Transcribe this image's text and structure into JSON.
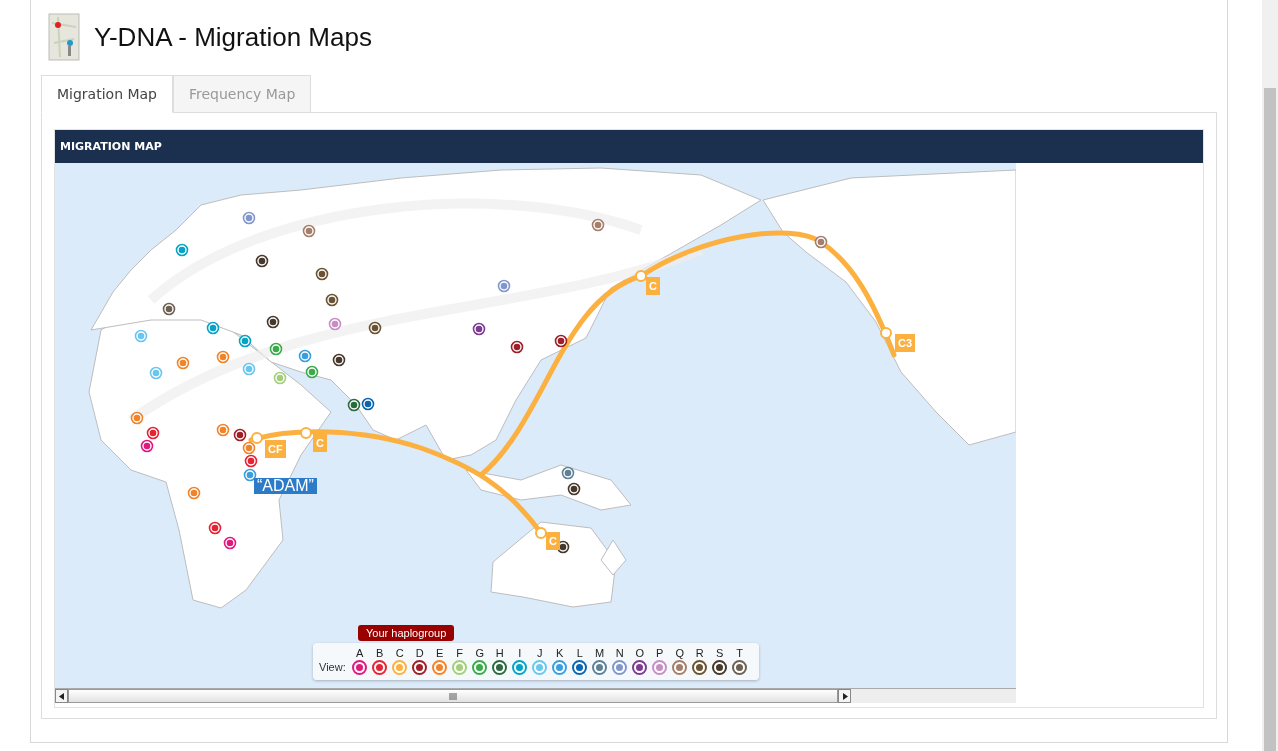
{
  "page": {
    "title": "Y-DNA - Migration Maps"
  },
  "tabs": [
    {
      "label": "Migration Map",
      "selected": true
    },
    {
      "label": "Frequency Map",
      "selected": false
    }
  ],
  "panel": {
    "title": "MIGRATION MAP"
  },
  "map": {
    "labels": [
      {
        "text": "CF",
        "kind": "route"
      },
      {
        "text": "C",
        "kind": "route"
      },
      {
        "text": "C",
        "kind": "route"
      },
      {
        "text": "C3",
        "kind": "route"
      },
      {
        "text": "C",
        "kind": "route"
      },
      {
        "text": "“ADAM”",
        "kind": "origin"
      }
    ]
  },
  "legend": {
    "label": "View:",
    "items": [
      {
        "letter": "A",
        "color": "#e0197d"
      },
      {
        "letter": "B",
        "color": "#e52334"
      },
      {
        "letter": "C",
        "color": "#fbb040",
        "tooltip": "Your haplogroup"
      },
      {
        "letter": "D",
        "color": "#9e1f27"
      },
      {
        "letter": "E",
        "color": "#f0842a"
      },
      {
        "letter": "F",
        "color": "#a3cf7a"
      },
      {
        "letter": "G",
        "color": "#3aab4a"
      },
      {
        "letter": "H",
        "color": "#2b6a3f"
      },
      {
        "letter": "I",
        "color": "#05a3c5"
      },
      {
        "letter": "J",
        "color": "#6ac6ee"
      },
      {
        "letter": "K",
        "color": "#3b9ede"
      },
      {
        "letter": "L",
        "color": "#0a64b0"
      },
      {
        "letter": "M",
        "color": "#5e8196"
      },
      {
        "letter": "N",
        "color": "#8196cc"
      },
      {
        "letter": "O",
        "color": "#7d3b91"
      },
      {
        "letter": "P",
        "color": "#c88dc3"
      },
      {
        "letter": "Q",
        "color": "#a57f6b"
      },
      {
        "letter": "R",
        "color": "#6a5332"
      },
      {
        "letter": "S",
        "color": "#46382b"
      },
      {
        "letter": "T",
        "color": "#6e6153"
      }
    ]
  }
}
